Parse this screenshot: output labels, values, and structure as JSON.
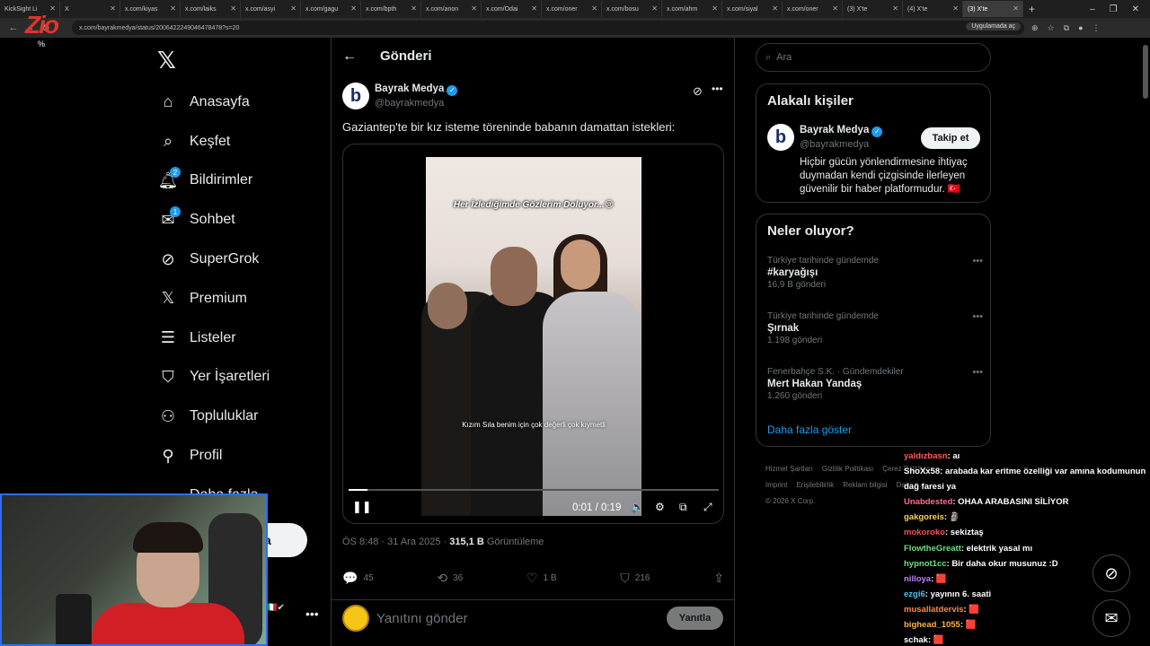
{
  "browser": {
    "tabs": [
      {
        "label": "KickSight Li",
        "active": false
      },
      {
        "label": "X",
        "active": false
      },
      {
        "label": "x.com/kiyas",
        "active": false
      },
      {
        "label": "x.com/laiks",
        "active": false
      },
      {
        "label": "x.com/asyi",
        "active": false
      },
      {
        "label": "x.com/gagu",
        "active": false
      },
      {
        "label": "x.com/bpth",
        "active": false
      },
      {
        "label": "x.com/anon",
        "active": false
      },
      {
        "label": "x.com/Odai",
        "active": false
      },
      {
        "label": "x.com/oner",
        "active": false
      },
      {
        "label": "x.com/bosu",
        "active": false
      },
      {
        "label": "x.com/ahm",
        "active": false
      },
      {
        "label": "x.com/siyal",
        "active": false
      },
      {
        "label": "x.com/oner",
        "active": false
      },
      {
        "label": "(3) X'te",
        "active": false
      },
      {
        "label": "(4) X'te",
        "active": false
      },
      {
        "label": "(3) X'te",
        "active": true
      }
    ],
    "url": "x.com/bayrakmedya/status/2006422249046478478?s=20",
    "app_button": "Uygulamada aç"
  },
  "overlay": {
    "logo": "Zio",
    "percent": "%"
  },
  "nav": {
    "items": [
      {
        "label": "Anasayfa",
        "icon": "home-icon",
        "badge": ""
      },
      {
        "label": "Keşfet",
        "icon": "search-icon",
        "badge": ""
      },
      {
        "label": "Bildirimler",
        "icon": "bell-icon",
        "badge": "2"
      },
      {
        "label": "Sohbet",
        "icon": "mail-icon",
        "badge": "1"
      },
      {
        "label": "SuperGrok",
        "icon": "grok-icon",
        "badge": ""
      },
      {
        "label": "Premium",
        "icon": "x-icon",
        "badge": ""
      },
      {
        "label": "Listeler",
        "icon": "list-icon",
        "badge": ""
      },
      {
        "label": "Yer İşaretleri",
        "icon": "bookmark-icon",
        "badge": ""
      },
      {
        "label": "Topluluklar",
        "icon": "people-icon",
        "badge": ""
      },
      {
        "label": "Profil",
        "icon": "person-icon",
        "badge": ""
      },
      {
        "label": "Daha fazla",
        "icon": "more-circle-icon",
        "badge": ""
      }
    ],
    "post_button": "a"
  },
  "post": {
    "header_title": "Gönderi",
    "author_name": "Bayrak Medya",
    "author_handle": "@bayrakmedya",
    "text": "Gaziantep'te bir kız isteme töreninde babanın damattan istekleri:",
    "video_caption_top": "Her İzlediğimde Gözlerim Doluyor...😢",
    "video_caption_bottom": "Kızım Sıla benim için çok değerli çok kıymetli",
    "video_time": "0:01 / 0:19",
    "video_progress": 0.05,
    "timestamp": "ÖS 8:48 · 31 Ara 2025 · ",
    "views_count": "315,1 B",
    "views_label": " Görüntüleme",
    "actions": {
      "replies": "45",
      "reposts": "36",
      "likes": "1 B",
      "bookmarks": "216"
    },
    "reply_placeholder": "Yanıtını gönder",
    "reply_button": "Yanıtla"
  },
  "sidebar": {
    "search_placeholder": "Ara",
    "related_title": "Alakalı kişiler",
    "related": {
      "name": "Bayrak Medya",
      "handle": "@bayrakmedya",
      "follow_label": "Takip et",
      "bio": "Hiçbir gücün yönlendirmesine ihtiyaç duymadan kendi çizgisinde ilerleyen güvenilir bir haber platformudur. 🇹🇷"
    },
    "trends_title": "Neler oluyor?",
    "trends": [
      {
        "context": "Türkiye tarihinde gündemde",
        "name": "#karyağışı",
        "count": "16,9 B gönderi"
      },
      {
        "context": "Türkiye tarihinde gündemde",
        "name": "Şırnak",
        "count": "1.198 gönderi"
      },
      {
        "context": "Fenerbahçe S.K. · Gündemdekiler",
        "name": "Mert Hakan Yandaş",
        "count": "1.260 gönderi"
      }
    ],
    "show_more": "Daha fazla göster",
    "footer_links": [
      "Hizmet Şartları",
      "Gizlilik Politikası",
      "Çerez Politikası",
      "Imprint",
      "Erişilebilirlik",
      "Reklam bilgisi",
      "Daha ...",
      "© 2026 X Corp."
    ]
  },
  "chat": [
    {
      "user": "yaldızbasn",
      "color": "#ff5a5a",
      "msg": ": aı"
    },
    {
      "user": "ShoXx58",
      "color": "#ffffff",
      "msg": ": arabada kar eritme özelliği var amına kodumunun dağ faresi ya"
    },
    {
      "user": "Unabdested",
      "color": "#ff6f8f",
      "msg": ": OHAA ARABASINI SİLİYOR"
    },
    {
      "user": "gakgoreis",
      "color": "#ffd24a",
      "msg": ": 🗿"
    },
    {
      "user": "mokoroko",
      "color": "#ff5050",
      "msg": ": sekiztaş"
    },
    {
      "user": "FlowtheGreatt",
      "color": "#6ee07a",
      "msg": ": elektrik yasal mı"
    },
    {
      "user": "hypnot1cc",
      "color": "#6ee07a",
      "msg": ": Bir daha okur musunuz :D"
    },
    {
      "user": "nilloya",
      "color": "#c77dff",
      "msg": ": 🟥"
    },
    {
      "user": "ezgi6",
      "color": "#4fc3f7",
      "msg": ": yayının 6. saati"
    },
    {
      "user": "musallatdervis",
      "color": "#ff8c42",
      "msg": ": 🟥"
    },
    {
      "user": "bighead_1055",
      "color": "#ffb347",
      "msg": ": 🟥"
    },
    {
      "user": "schak",
      "color": "#ffffff",
      "msg": ": 🟥"
    }
  ],
  "colors": {
    "accent": "#1d9bf0",
    "background": "#000000",
    "border": "#2f3336",
    "webcam_border": "#2d6ff2"
  }
}
